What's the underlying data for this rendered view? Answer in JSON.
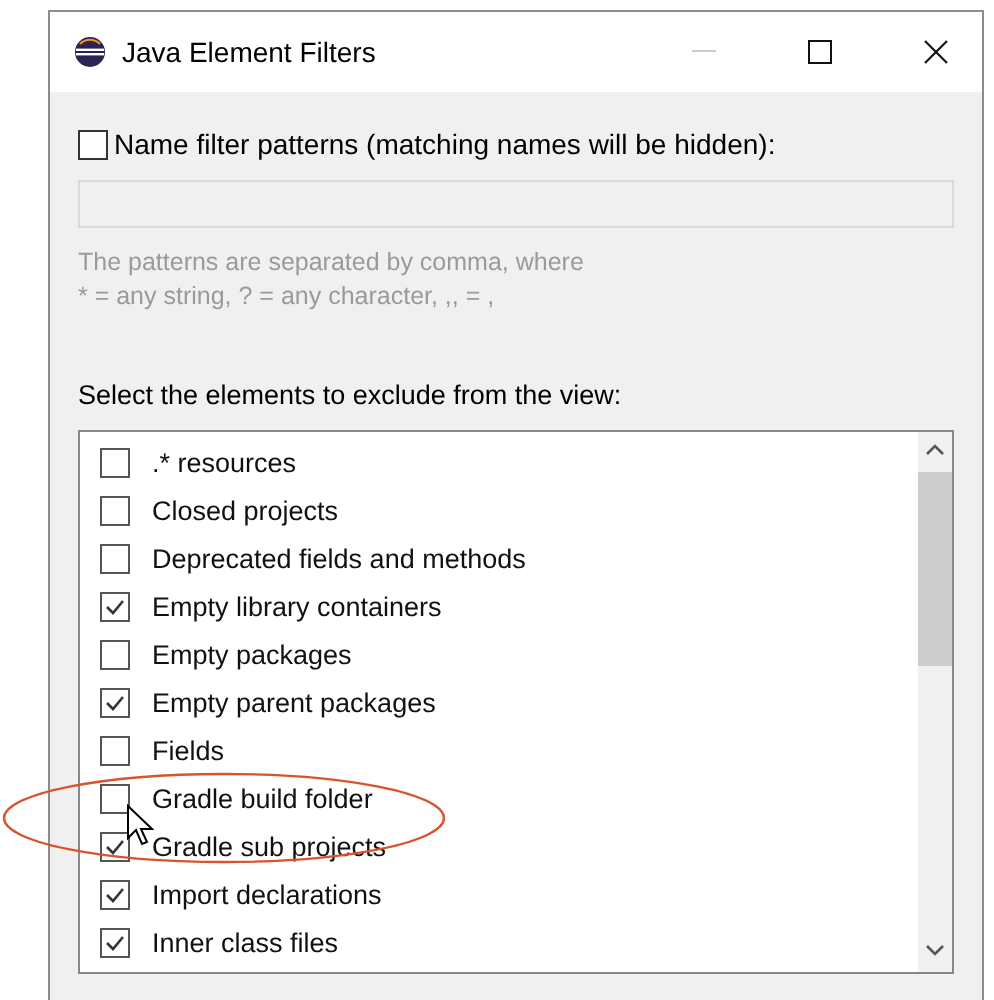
{
  "window": {
    "title": "Java Element Filters"
  },
  "name_filter": {
    "label": "Name filter patterns (matching names will be hidden):",
    "checked": false,
    "hint_lines": [
      "The patterns are separated by comma, where",
      "* = any string, ? = any character, ,, = ,"
    ]
  },
  "elements_label": "Select the elements to exclude from the view:",
  "elements": [
    {
      "label": ".* resources",
      "checked": false
    },
    {
      "label": "Closed projects",
      "checked": false
    },
    {
      "label": "Deprecated fields and methods",
      "checked": false
    },
    {
      "label": "Empty library containers",
      "checked": true
    },
    {
      "label": "Empty packages",
      "checked": false
    },
    {
      "label": "Empty parent packages",
      "checked": true
    },
    {
      "label": "Fields",
      "checked": false
    },
    {
      "label": "Gradle build folder",
      "checked": false
    },
    {
      "label": "Gradle sub projects",
      "checked": true
    },
    {
      "label": "Import declarations",
      "checked": true
    },
    {
      "label": "Inner class files",
      "checked": true
    }
  ]
}
